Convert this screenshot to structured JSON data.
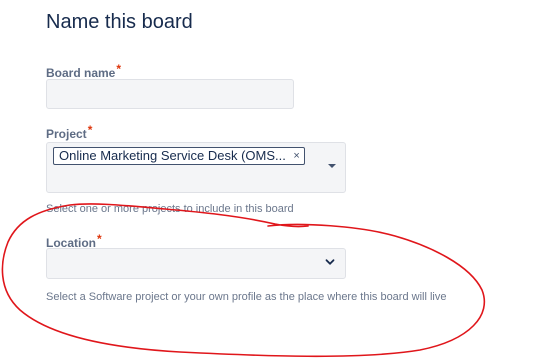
{
  "form": {
    "title": "Name this board",
    "board_name": {
      "label": "Board name",
      "required_mark": "*",
      "value": ""
    },
    "project": {
      "label": "Project",
      "required_mark": "*",
      "selected_chip": "Online Marketing Service Desk (OMS...",
      "chip_remove_glyph": "×",
      "helper": "Select one or more projects to include in this board"
    },
    "location": {
      "label": "Location",
      "required_mark": "*",
      "value": "",
      "helper": "Select a Software project or your own profile as the place where this board will live"
    }
  },
  "annotation": {
    "color": "#E0161B",
    "shape": "freehand-ellipse"
  },
  "icons": {
    "project_dropdown": "caret-down-icon",
    "location_dropdown": "chevron-down-icon",
    "chip_remove": "close-icon"
  }
}
